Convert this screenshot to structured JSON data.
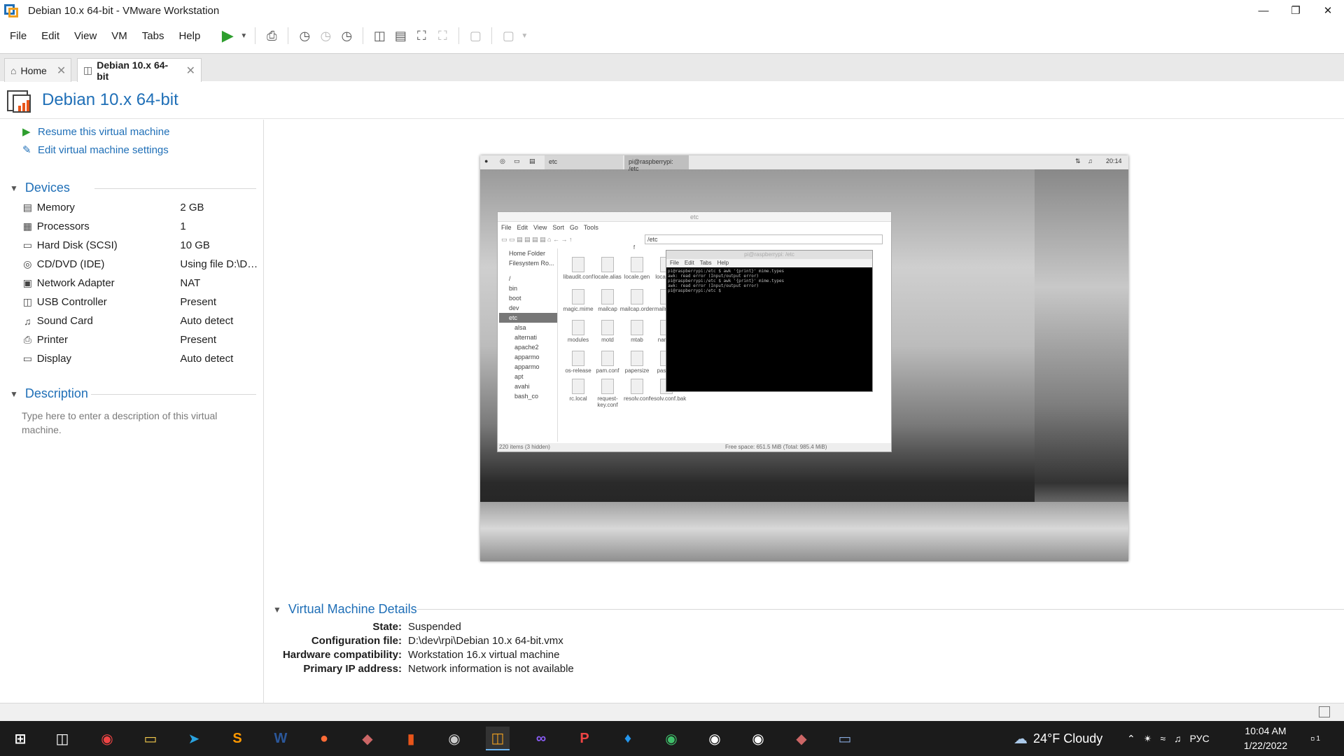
{
  "window": {
    "title": "Debian 10.x 64-bit - VMware Workstation"
  },
  "menu": [
    "File",
    "Edit",
    "View",
    "VM",
    "Tabs",
    "Help"
  ],
  "tabs": [
    {
      "label": "Home"
    },
    {
      "label": "Debian 10.x 64-bit"
    }
  ],
  "vm": {
    "name": "Debian 10.x 64-bit"
  },
  "actions": {
    "resume": "Resume this virtual machine",
    "edit": "Edit virtual machine settings"
  },
  "devices": {
    "heading": "Devices",
    "items": [
      {
        "name": "Memory",
        "value": "2 GB",
        "icon": "memory-icon"
      },
      {
        "name": "Processors",
        "value": "1",
        "icon": "processor-icon"
      },
      {
        "name": "Hard Disk (SCSI)",
        "value": "10 GB",
        "icon": "harddisk-icon"
      },
      {
        "name": "CD/DVD (IDE)",
        "value": "Using file D:\\DId...",
        "icon": "cdrom-icon"
      },
      {
        "name": "Network Adapter",
        "value": "NAT",
        "icon": "network-icon"
      },
      {
        "name": "USB Controller",
        "value": "Present",
        "icon": "usb-icon"
      },
      {
        "name": "Sound Card",
        "value": "Auto detect",
        "icon": "sound-icon"
      },
      {
        "name": "Printer",
        "value": "Present",
        "icon": "printer-icon"
      },
      {
        "name": "Display",
        "value": "Auto detect",
        "icon": "display-icon"
      }
    ]
  },
  "description": {
    "heading": "Description",
    "placeholder": "Type here to enter a description of this virtual machine."
  },
  "guest": {
    "panel_item": "etc",
    "panel_item2": "pi@raspberrypi: /etc",
    "panel_time": "20:14",
    "fm_title": "etc",
    "fm_menu": [
      "File",
      "Edit",
      "View",
      "Sort",
      "Go",
      "Tools"
    ],
    "fm_path": "/etc",
    "fm_places": [
      "Home Folder",
      "Filesystem Ro..."
    ],
    "fm_tree": [
      "/",
      "bin",
      "boot",
      "dev",
      "etc",
      "alsa",
      "alternati",
      "apache2",
      "apparmo",
      "apparmo",
      "apt",
      "avahi",
      "bash_co"
    ],
    "fm_col_header": "f",
    "fm_files": [
      "libaudit.conf",
      "locale.alias",
      "locale.gen",
      "localtime",
      "magic.mime",
      "mailcap",
      "mailcap.order",
      "mailname",
      "modules",
      "motd",
      "mtab",
      "nanorc",
      "os-release",
      "pam.conf",
      "papersize",
      "passwd",
      "rc.local",
      "request-key.conf",
      "resolv.conf",
      "resolv.conf.bak"
    ],
    "fm_status_left": "220 items (3 hidden)",
    "fm_status_right": "Free space: 651.5 MiB (Total: 985.4 MiB)",
    "term_title": "pi@raspberrypi: /etc",
    "term_menu": [
      "File",
      "Edit",
      "Tabs",
      "Help"
    ],
    "term_lines": "pi@raspberrypi:/etc $ awk '{print}' mime.types\nawk: read error (Input/output error)\npi@raspberrypi:/etc $ awk '{print}' mime.types\nawk: read error (Input/output error)\npi@raspberrypi:/etc $ "
  },
  "details": {
    "heading": "Virtual Machine Details",
    "rows": [
      {
        "k": "State:",
        "v": "Suspended"
      },
      {
        "k": "Configuration file:",
        "v": "D:\\dev\\rpi\\Debian 10.x 64-bit.vmx"
      },
      {
        "k": "Hardware compatibility:",
        "v": "Workstation 16.x virtual machine"
      },
      {
        "k": "Primary IP address:",
        "v": "Network information is not available"
      }
    ]
  },
  "taskbar": {
    "weather": "24°F  Cloudy",
    "lang": "РУС",
    "time": "10:04 AM",
    "date": "1/22/2022",
    "notif_count": "1",
    "apps": [
      "chrome-icon",
      "explorer-icon",
      "telegram-icon",
      "sublime-icon",
      "word-icon",
      "postman-icon",
      "git-icon",
      "office-icon",
      "vpn-icon",
      "vmware-icon",
      "visualstudio-icon",
      "paw-icon",
      "docker-icon",
      "edge-icon",
      "wps-icon",
      "bridge-icon",
      "git-icon-2",
      "notes-icon"
    ]
  }
}
